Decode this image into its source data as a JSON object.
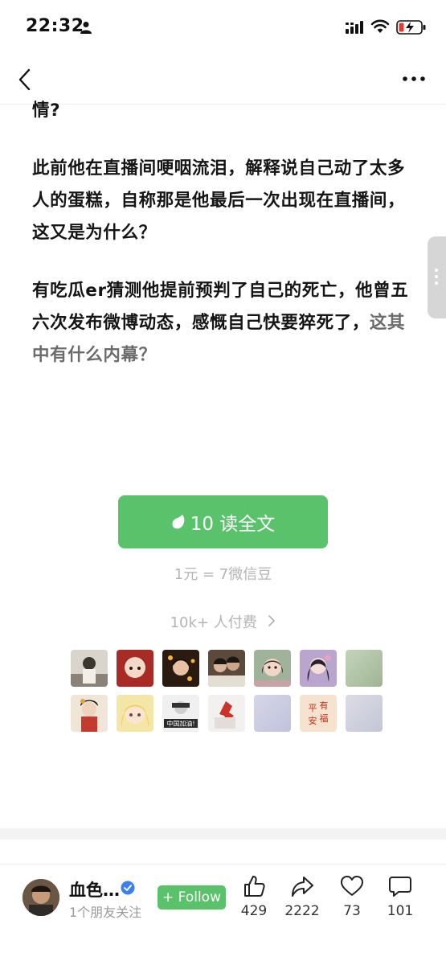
{
  "status_bar": {
    "time": "22:32"
  },
  "article": {
    "paragraphs": [
      {
        "text": "情?"
      },
      {
        "text": "此前他在直播间哽咽流泪，解释说自己动了太多人的蛋糕，自称那是他最后一次出现在直播间，这又是为什么？"
      },
      {
        "text": "有吃瓜er猜测他提前预判了自己的死亡，他曾五六次发布微博动态，感慨自己快要猝死了，",
        "dim_tail": "这其中有什么内幕？"
      }
    ]
  },
  "paywall": {
    "read_button_label": "10 读全文",
    "price_note": "1元 = 7微信豆",
    "payers_label": "10k+ 人付费",
    "payer_avatar_count": 14
  },
  "author": {
    "name": "血色…",
    "friend_note": "1个朋友关注",
    "follow_label": "+ Follow"
  },
  "stats": {
    "likes": "429",
    "shares": "2222",
    "favorites": "73",
    "comments": "101"
  },
  "colors": {
    "accent_green": "#5ac26b",
    "muted_text": "#b4b4b4",
    "verified_blue": "#3d7ef0"
  },
  "icons": [
    "person-icon",
    "signal-icon",
    "wifi-icon",
    "battery-icon",
    "back-icon",
    "more-icon",
    "bean-icon",
    "chevron-right-icon",
    "verified-icon",
    "thumbs-up-icon",
    "share-icon",
    "heart-icon",
    "comment-icon"
  ]
}
